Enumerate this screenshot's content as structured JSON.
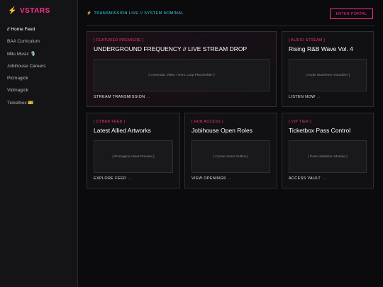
{
  "brand": {
    "bolt": "⚡",
    "name": "VSTARS"
  },
  "nav": [
    "// Home Feed",
    "BAA Curriculum",
    "Milu Music 🎙️",
    "Jobihouse Careers",
    "Picmagick",
    "Vidmagick",
    "Ticketbox 🎫"
  ],
  "header": {
    "bolt": "⚡",
    "status": "TRANSMISSION LIVE // SYSTEM NOMINAL",
    "enter_label": "ENTER PORTAL"
  },
  "cards": [
    {
      "tag": "[ FEATURED PREMIERE ]",
      "title": "UNDERGROUND FREQUENCY // LIVE STREAM DROP",
      "placeholder": "[ Cinematic Video / Hero Loop Placeholder ]",
      "cta": "STREAM TRANSMISSION",
      "arrow": "→"
    },
    {
      "tag": "[ AUDIO STREAM ]",
      "title": "Rising R&B Wave Vol. 4",
      "placeholder": "[ Audio Waveform Visualizer ]",
      "cta": "LISTEN NOW",
      "arrow": "→"
    },
    {
      "tag": "[ CYBER FEED ]",
      "title": "Latest Allied Artworks",
      "placeholder": "[ Picmagica Asset Preview ]",
      "cta": "EXPLORE FEED",
      "arrow": "→"
    },
    {
      "tag": "[ HUB ACCESS ]",
      "title": "Jobihouse Open Roles",
      "placeholder": "[ Career Index Outline ]",
      "cta": "VIEW OPENINGS",
      "arrow": "→"
    },
    {
      "tag": "[ VIP TIER ]",
      "title": "Ticketbox Pass Control",
      "placeholder": "[ Pass Validation Module ]",
      "cta": "ACCESS VAULT",
      "arrow": "→"
    }
  ],
  "colors": {
    "accent": "#ff2d8a",
    "status": "#35d0e8",
    "bolt": "#ffd21f",
    "background": "#0b0b0d"
  }
}
